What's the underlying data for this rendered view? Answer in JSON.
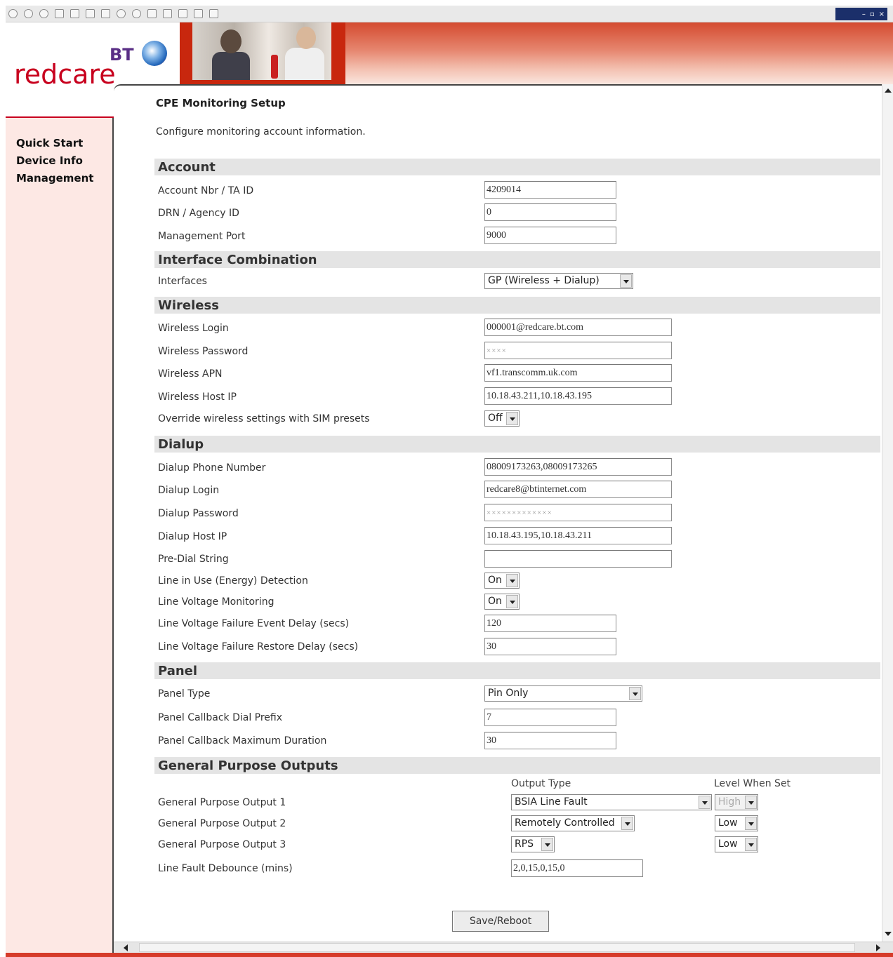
{
  "header": {
    "brand": "redcare",
    "brand_parent": "BT"
  },
  "window_controls": {
    "minimize": "–",
    "restore": "▫",
    "close": "×"
  },
  "sidebar": {
    "items": [
      "Quick Start",
      "Device Info",
      "Management"
    ]
  },
  "page": {
    "title": "CPE Monitoring Setup",
    "subtitle": "Configure monitoring account information."
  },
  "account": {
    "heading": "Account",
    "account_nbr_label": "Account Nbr / TA ID",
    "account_nbr_value": "4209014",
    "drn_label": "DRN / Agency ID",
    "drn_value": "0",
    "mgmt_port_label": "Management Port",
    "mgmt_port_value": "9000"
  },
  "interface": {
    "heading": "Interface Combination",
    "interfaces_label": "Interfaces",
    "interfaces_value": "GP (Wireless + Dialup)"
  },
  "wireless": {
    "heading": "Wireless",
    "login_label": "Wireless Login",
    "login_value": "000001@redcare.bt.com",
    "password_label": "Wireless Password",
    "password_value": "××××",
    "apn_label": "Wireless APN",
    "apn_value": "vf1.transcomm.uk.com",
    "host_label": "Wireless Host IP",
    "host_value": "10.18.43.211,10.18.43.195",
    "override_label": "Override wireless settings with SIM presets",
    "override_value": "Off"
  },
  "dialup": {
    "heading": "Dialup",
    "phone_label": "Dialup Phone Number",
    "phone_value": "08009173263,08009173265",
    "login_label": "Dialup Login",
    "login_value": "redcare8@btinternet.com",
    "password_label": "Dialup Password",
    "password_value": "×××××××××××××",
    "host_label": "Dialup Host IP",
    "host_value": "10.18.43.195,10.18.43.211",
    "predial_label": "Pre-Dial String",
    "predial_value": "",
    "line_in_use_label": "Line in Use (Energy) Detection",
    "line_in_use_value": "On",
    "voltage_mon_label": "Line Voltage Monitoring",
    "voltage_mon_value": "On",
    "fail_event_label": "Line Voltage Failure Event Delay (secs)",
    "fail_event_value": "120",
    "fail_restore_label": "Line Voltage Failure Restore Delay (secs)",
    "fail_restore_value": "30"
  },
  "panel": {
    "heading": "Panel",
    "type_label": "Panel Type",
    "type_value": "Pin Only",
    "prefix_label": "Panel Callback Dial Prefix",
    "prefix_value": "7",
    "duration_label": "Panel Callback Maximum Duration",
    "duration_value": "30"
  },
  "gpo": {
    "heading": "General Purpose Outputs",
    "col_output_type": "Output Type",
    "col_level": "Level When Set",
    "rows": [
      {
        "label": "General Purpose Output 1",
        "type": "BSIA Line Fault",
        "level": "High"
      },
      {
        "label": "General Purpose Output 2",
        "type": "Remotely Controlled",
        "level": "Low"
      },
      {
        "label": "General Purpose Output 3",
        "type": "RPS",
        "level": "Low"
      }
    ],
    "debounce_label": "Line Fault Debounce (mins)",
    "debounce_value": "2,0,15,0,15,0"
  },
  "actions": {
    "save_label": "Save/Reboot"
  },
  "colors": {
    "brand_red": "#c8001e",
    "bt_purple": "#5a2f86",
    "sidebar_bg": "#fde8e4",
    "section_bg": "#e4e4e4"
  }
}
